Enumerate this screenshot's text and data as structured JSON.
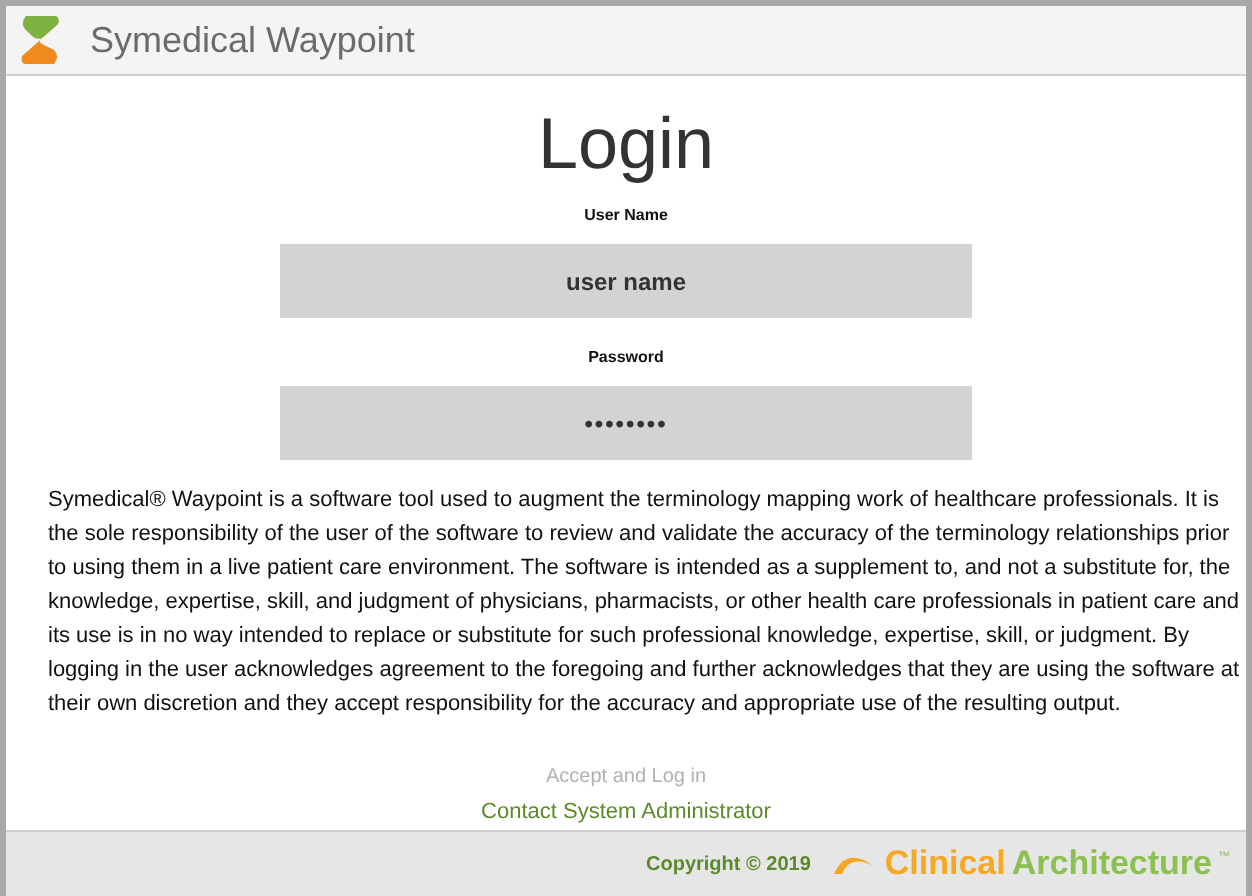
{
  "header": {
    "title": "Symedical Waypoint"
  },
  "login": {
    "heading": "Login",
    "fields": [
      {
        "label": "User Name",
        "placeholder": "user name",
        "kind": "text"
      },
      {
        "label": "Password",
        "value": "••••••••",
        "kind": "password"
      }
    ],
    "disclaimer": "Symedical® Waypoint is a software tool used to augment the terminology mapping work of healthcare professionals. It is the sole responsibility of the user of the software to review and validate the accuracy of the terminology relationships prior to using them in a live patient care environment. The software is intended as a supplement to, and not a substitute for, the knowledge, expertise, skill, and judgment of physicians, pharmacists, or other health care professionals in patient care and its use is in no way intended to replace or substitute for such professional knowledge, expertise, skill, or judgment. By logging in the user acknowledges agreement to the foregoing and further acknowledges that they are using the software at their own discretion and they accept responsibility for the accuracy and appropriate use of the resulting output.",
    "accept_button": {
      "label": "Accept and Log in",
      "disabled": true
    },
    "contact_link": "Contact System Administrator"
  },
  "footer": {
    "copyright": "Copyright © 2019",
    "logo_word_1": "Clinical",
    "logo_word_2": "Architecture",
    "logo_mark": "™"
  }
}
